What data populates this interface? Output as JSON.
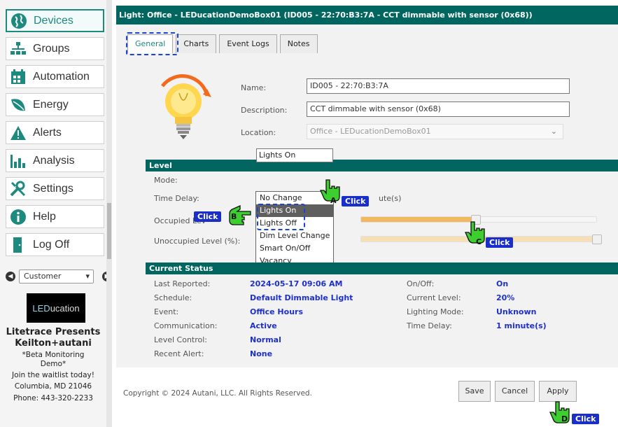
{
  "sidebar": {
    "items": [
      {
        "label": "Devices",
        "icon": "devices-globe-icon"
      },
      {
        "label": "Groups",
        "icon": "groups-hierarchy-icon"
      },
      {
        "label": "Automation",
        "icon": "automation-calendar-icon"
      },
      {
        "label": "Energy",
        "icon": "energy-leaf-icon"
      },
      {
        "label": "Alerts",
        "icon": "alert-triangle-icon"
      },
      {
        "label": "Analysis",
        "icon": "bar-chart-icon"
      },
      {
        "label": "Settings",
        "icon": "wrench-screwdriver-icon"
      },
      {
        "label": "Help",
        "icon": "info-icon"
      },
      {
        "label": "Log Off",
        "icon": "door-exit-icon"
      }
    ],
    "customer_select": "Customer",
    "logo_text_a": "LED",
    "logo_text_b": "ucation",
    "promo": {
      "line1": "Litetrace Presents",
      "line2": "Keilton+autani",
      "line3": "*Beta Monitoring",
      "line4": "Demo*",
      "line5": "Join the waitlist today!",
      "line6": "Columbia, MD  21046",
      "line7": "Phone: 443-320-2233"
    }
  },
  "header": {
    "title": "Light: Office - LEDucationDemoBox01 (ID005 - 22:70:B3:7A - CCT dimmable with sensor (0x68))"
  },
  "tabs": [
    "General",
    "Charts",
    "Event Logs",
    "Notes"
  ],
  "form": {
    "name_label": "Name:",
    "name_value": "ID005 - 22:70:B3:7A",
    "description_label": "Description:",
    "description_value": "CCT dimmable with sensor (0x68)",
    "location_label": "Location:",
    "location_value": "Office - LEDucationDemoBox01"
  },
  "level": {
    "header": "Level",
    "mode_label": "Mode:",
    "mode_value": "Lights On",
    "time_delay_label": "Time Delay:",
    "time_delay_unit": "ute(s)",
    "occupied_label": "Occupied Lev",
    "unoccupied_label": "Unoccupied Level (%):",
    "occupied_fill": 0.47,
    "unoccupied_fill": 0.5,
    "dropdown_options": [
      "No Change",
      "Lights On",
      "Lights Off",
      "Dim Level Change",
      "Smart On/Off",
      "Vacancy"
    ]
  },
  "status": {
    "header": "Current Status",
    "rows_left": [
      {
        "label": "Last Reported:",
        "value": "2024-05-17 09:06 AM"
      },
      {
        "label": "Schedule:",
        "value": "Default Dimmable Light"
      },
      {
        "label": "Event:",
        "value": "Office Hours"
      },
      {
        "label": "Communication:",
        "value": "Active"
      },
      {
        "label": "Level Control:",
        "value": "Normal"
      },
      {
        "label": "Recent Alert:",
        "value": "None"
      }
    ],
    "rows_right": [
      {
        "label": "On/Off:",
        "value": "On"
      },
      {
        "label": "Current Level:",
        "value": "20%"
      },
      {
        "label": "Lighting Mode:",
        "value": "Unknown"
      },
      {
        "label": "Time Delay:",
        "value": "1 minute(s)"
      }
    ]
  },
  "footer": {
    "copyright": "Copyright © 2024 Autani, LLC. All Rights Reserved.",
    "save": "Save",
    "cancel": "Cancel",
    "apply": "Apply"
  },
  "annotations": {
    "click": "Click",
    "a": "A",
    "b": "B",
    "c": "C",
    "d": "D"
  },
  "colors": {
    "accent_teal": "#00665f",
    "highlight_blue": "#1a2fc9",
    "slider_orange": "#f2b860",
    "pointer_green": "#3ccf2f"
  }
}
